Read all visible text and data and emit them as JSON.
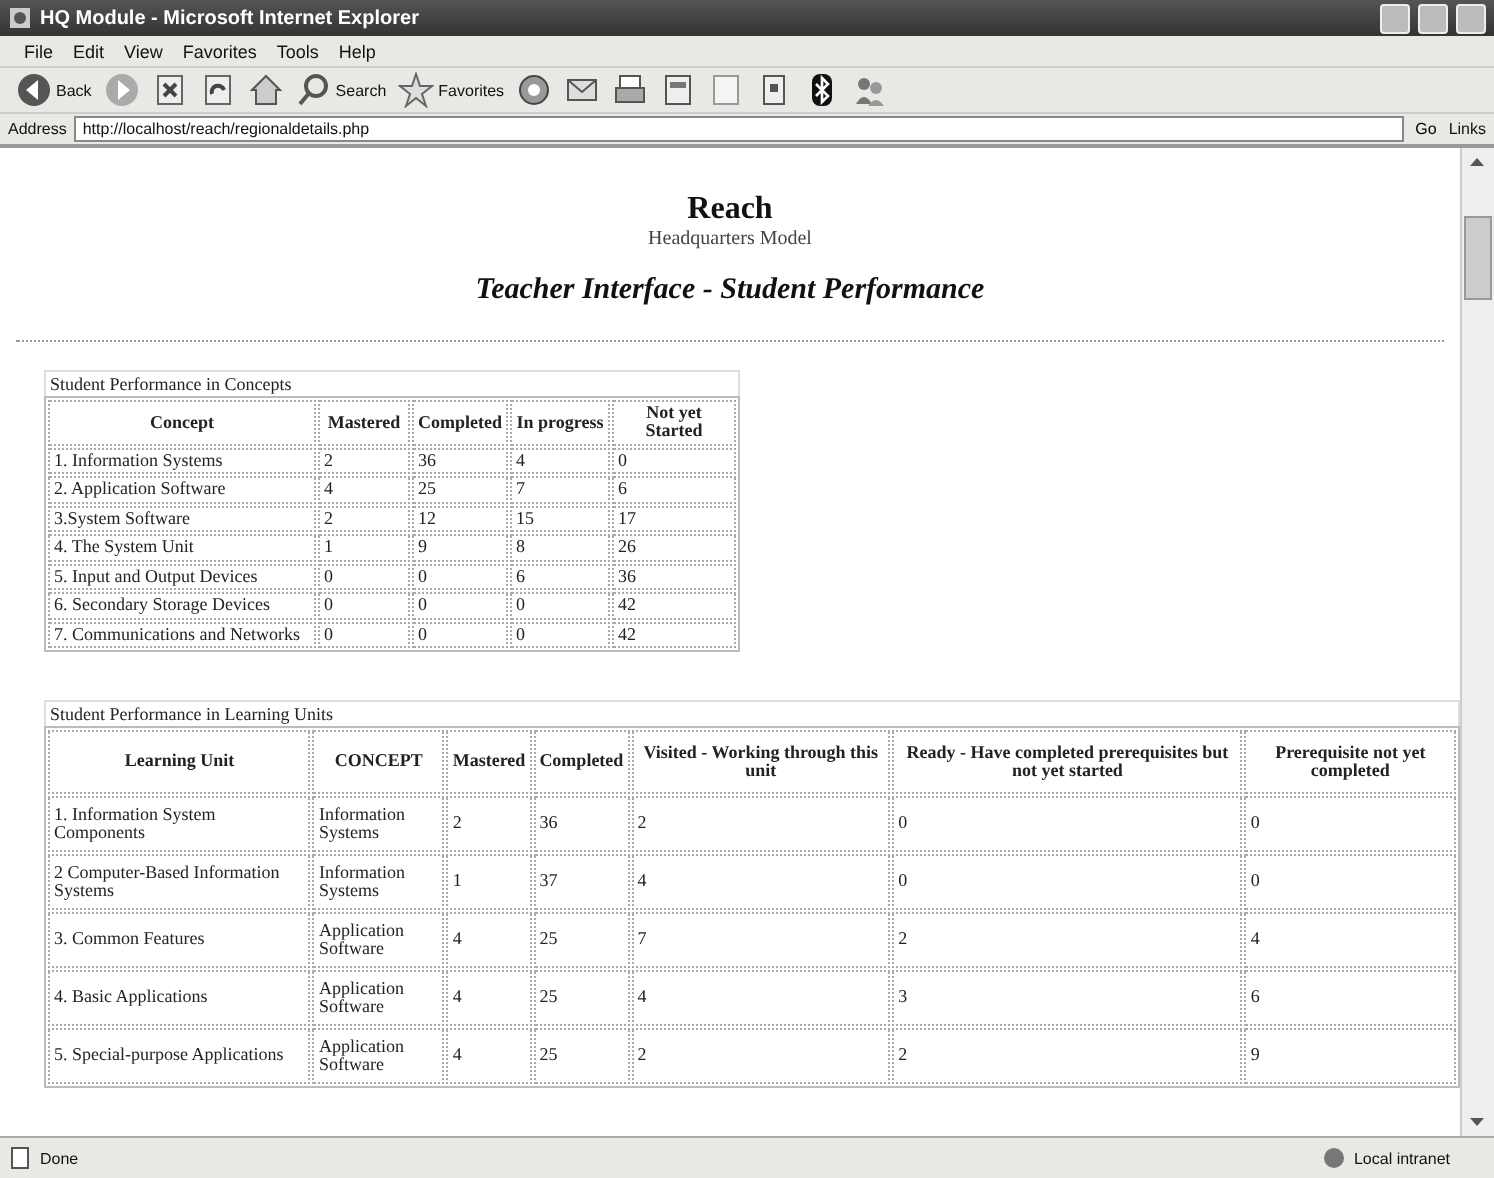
{
  "window": {
    "title": "HQ Module - Microsoft Internet Explorer"
  },
  "menu": [
    "File",
    "Edit",
    "View",
    "Favorites",
    "Tools",
    "Help"
  ],
  "toolbar": [
    {
      "kind": "back",
      "label": "Back"
    },
    {
      "kind": "forward"
    },
    {
      "kind": "stop"
    },
    {
      "kind": "refresh"
    },
    {
      "kind": "home"
    },
    {
      "kind": "search",
      "label": "Search"
    },
    {
      "kind": "favorites",
      "label": "Favorites"
    },
    {
      "kind": "media"
    },
    {
      "kind": "mail"
    },
    {
      "kind": "print"
    },
    {
      "kind": "edit"
    },
    {
      "kind": "page"
    },
    {
      "kind": "phone"
    },
    {
      "kind": "bluetooth"
    },
    {
      "kind": "people"
    }
  ],
  "address": {
    "label": "Address",
    "value": "http://localhost/reach/regionaldetails.php",
    "go": "Go",
    "links": "Links"
  },
  "page": {
    "heading": "Reach",
    "subheading": "Headquarters Model",
    "title": "Teacher Interface - Student Performance"
  },
  "concepts_table": {
    "caption": "Student Performance in Concepts",
    "columns": [
      "Concept",
      "Mastered",
      "Completed",
      "In progress",
      "Not yet Started"
    ],
    "rows": [
      [
        "1. Information Systems",
        "2",
        "36",
        "4",
        "0"
      ],
      [
        "2. Application Software",
        "4",
        "25",
        "7",
        "6"
      ],
      [
        "3.System Software",
        "2",
        "12",
        "15",
        "17"
      ],
      [
        "4. The System Unit",
        "1",
        "9",
        "8",
        "26"
      ],
      [
        "5. Input and Output Devices",
        "0",
        "0",
        "6",
        "36"
      ],
      [
        "6. Secondary Storage Devices",
        "0",
        "0",
        "0",
        "42"
      ],
      [
        "7. Communications and Networks",
        "0",
        "0",
        "0",
        "42"
      ]
    ]
  },
  "units_table": {
    "caption": "Student Performance in Learning Units",
    "columns": [
      "Learning Unit",
      "CONCEPT",
      "Mastered",
      "Completed",
      "Visited - Working through this unit",
      "Ready - Have completed prerequisites but not yet started",
      "Prerequisite not yet completed"
    ],
    "rows": [
      [
        "1. Information System Components",
        "Information Systems",
        "2",
        "36",
        "2",
        "0",
        "0"
      ],
      [
        "2 Computer-Based Information Systems",
        "Information Systems",
        "1",
        "37",
        "4",
        "0",
        "0"
      ],
      [
        "3. Common Features",
        "Application Software",
        "4",
        "25",
        "7",
        "2",
        "4"
      ],
      [
        "4. Basic Applications",
        "Application Software",
        "4",
        "25",
        "4",
        "3",
        "6"
      ],
      [
        "5. Special-purpose Applications",
        "Application Software",
        "4",
        "25",
        "2",
        "2",
        "9"
      ]
    ]
  },
  "status_bar": {
    "text": "Done",
    "zone": "Local intranet"
  }
}
